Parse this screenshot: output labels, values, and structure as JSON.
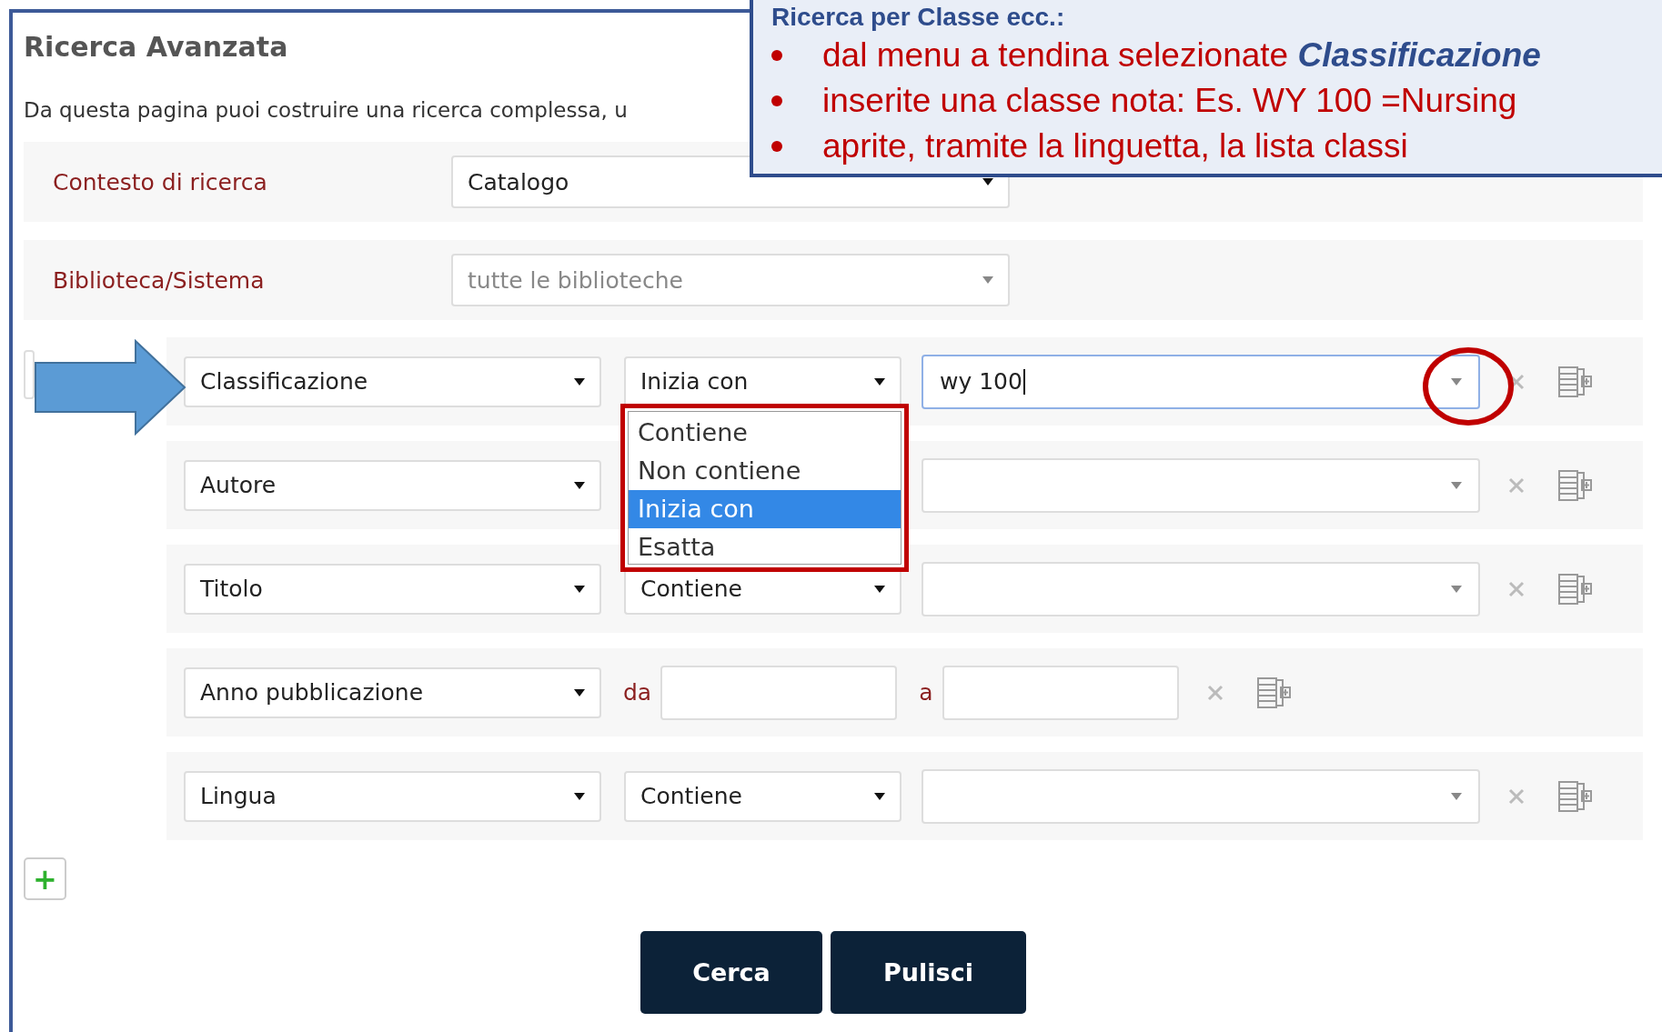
{
  "page": {
    "title": "Ricerca Avanzata",
    "description": "Da questa pagina puoi costruire una ricerca complessa, u"
  },
  "context_fields": [
    {
      "label": "Contesto di ricerca",
      "value": "Catalogo"
    },
    {
      "label": "Biblioteca/Sistema",
      "placeholder": "tutte le biblioteche"
    }
  ],
  "query_rows": [
    {
      "kind": "text",
      "field": "Classificazione",
      "operator": "Inizia con",
      "value": "wy 100",
      "focused": true
    },
    {
      "kind": "text",
      "field": "Autore",
      "focused": false
    },
    {
      "kind": "text",
      "field": "Titolo",
      "operator": "Contiene",
      "focused": false
    },
    {
      "kind": "range",
      "field": "Anno pubblicazione",
      "from_label": "da",
      "to_label": "a"
    },
    {
      "kind": "text",
      "field": "Lingua",
      "operator": "Contiene",
      "focused": false
    }
  ],
  "operator_dropdown": {
    "options": [
      {
        "label": "Contiene",
        "selected": false
      },
      {
        "label": "Non contiene",
        "selected": false
      },
      {
        "label": "Inizia con",
        "selected": true
      },
      {
        "label": "Esatta",
        "selected": false
      }
    ]
  },
  "add_button": "+",
  "buttons": [
    "Cerca",
    "Pulisci"
  ],
  "callout": {
    "title": "Ricerca per Classe ecc.:",
    "bullets": [
      "dal menu a tendina selezionate **Classificazione**",
      "inserite una classe nota: Es. WY 100 =Nursing",
      "aprite, tramite la linguetta, la lista classi"
    ]
  }
}
